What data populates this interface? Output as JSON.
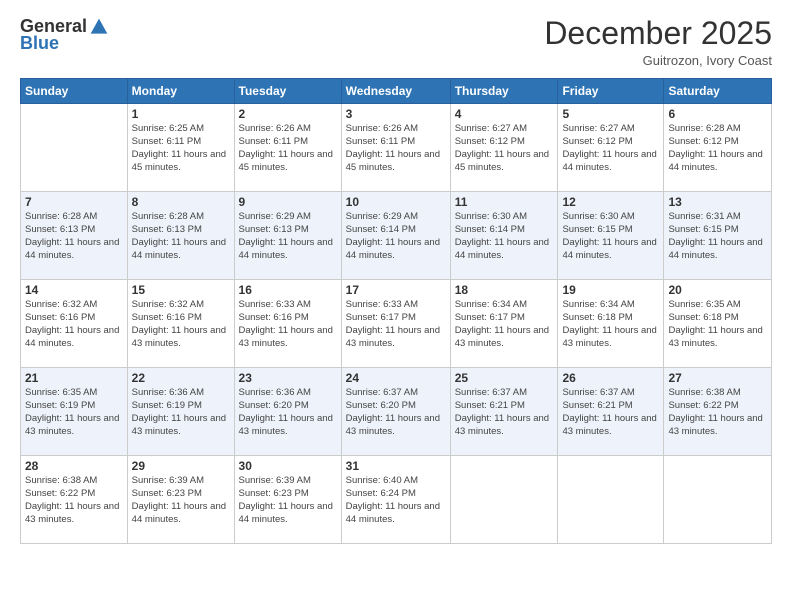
{
  "header": {
    "logo_general": "General",
    "logo_blue": "Blue",
    "month": "December 2025",
    "location": "Guitrozon, Ivory Coast"
  },
  "days_of_week": [
    "Sunday",
    "Monday",
    "Tuesday",
    "Wednesday",
    "Thursday",
    "Friday",
    "Saturday"
  ],
  "weeks": [
    [
      {
        "day": "",
        "sunrise": "",
        "sunset": "",
        "daylight": ""
      },
      {
        "day": "1",
        "sunrise": "Sunrise: 6:25 AM",
        "sunset": "Sunset: 6:11 PM",
        "daylight": "Daylight: 11 hours and 45 minutes."
      },
      {
        "day": "2",
        "sunrise": "Sunrise: 6:26 AM",
        "sunset": "Sunset: 6:11 PM",
        "daylight": "Daylight: 11 hours and 45 minutes."
      },
      {
        "day": "3",
        "sunrise": "Sunrise: 6:26 AM",
        "sunset": "Sunset: 6:11 PM",
        "daylight": "Daylight: 11 hours and 45 minutes."
      },
      {
        "day": "4",
        "sunrise": "Sunrise: 6:27 AM",
        "sunset": "Sunset: 6:12 PM",
        "daylight": "Daylight: 11 hours and 45 minutes."
      },
      {
        "day": "5",
        "sunrise": "Sunrise: 6:27 AM",
        "sunset": "Sunset: 6:12 PM",
        "daylight": "Daylight: 11 hours and 44 minutes."
      },
      {
        "day": "6",
        "sunrise": "Sunrise: 6:28 AM",
        "sunset": "Sunset: 6:12 PM",
        "daylight": "Daylight: 11 hours and 44 minutes."
      }
    ],
    [
      {
        "day": "7",
        "sunrise": "Sunrise: 6:28 AM",
        "sunset": "Sunset: 6:13 PM",
        "daylight": "Daylight: 11 hours and 44 minutes."
      },
      {
        "day": "8",
        "sunrise": "Sunrise: 6:28 AM",
        "sunset": "Sunset: 6:13 PM",
        "daylight": "Daylight: 11 hours and 44 minutes."
      },
      {
        "day": "9",
        "sunrise": "Sunrise: 6:29 AM",
        "sunset": "Sunset: 6:13 PM",
        "daylight": "Daylight: 11 hours and 44 minutes."
      },
      {
        "day": "10",
        "sunrise": "Sunrise: 6:29 AM",
        "sunset": "Sunset: 6:14 PM",
        "daylight": "Daylight: 11 hours and 44 minutes."
      },
      {
        "day": "11",
        "sunrise": "Sunrise: 6:30 AM",
        "sunset": "Sunset: 6:14 PM",
        "daylight": "Daylight: 11 hours and 44 minutes."
      },
      {
        "day": "12",
        "sunrise": "Sunrise: 6:30 AM",
        "sunset": "Sunset: 6:15 PM",
        "daylight": "Daylight: 11 hours and 44 minutes."
      },
      {
        "day": "13",
        "sunrise": "Sunrise: 6:31 AM",
        "sunset": "Sunset: 6:15 PM",
        "daylight": "Daylight: 11 hours and 44 minutes."
      }
    ],
    [
      {
        "day": "14",
        "sunrise": "Sunrise: 6:32 AM",
        "sunset": "Sunset: 6:16 PM",
        "daylight": "Daylight: 11 hours and 44 minutes."
      },
      {
        "day": "15",
        "sunrise": "Sunrise: 6:32 AM",
        "sunset": "Sunset: 6:16 PM",
        "daylight": "Daylight: 11 hours and 43 minutes."
      },
      {
        "day": "16",
        "sunrise": "Sunrise: 6:33 AM",
        "sunset": "Sunset: 6:16 PM",
        "daylight": "Daylight: 11 hours and 43 minutes."
      },
      {
        "day": "17",
        "sunrise": "Sunrise: 6:33 AM",
        "sunset": "Sunset: 6:17 PM",
        "daylight": "Daylight: 11 hours and 43 minutes."
      },
      {
        "day": "18",
        "sunrise": "Sunrise: 6:34 AM",
        "sunset": "Sunset: 6:17 PM",
        "daylight": "Daylight: 11 hours and 43 minutes."
      },
      {
        "day": "19",
        "sunrise": "Sunrise: 6:34 AM",
        "sunset": "Sunset: 6:18 PM",
        "daylight": "Daylight: 11 hours and 43 minutes."
      },
      {
        "day": "20",
        "sunrise": "Sunrise: 6:35 AM",
        "sunset": "Sunset: 6:18 PM",
        "daylight": "Daylight: 11 hours and 43 minutes."
      }
    ],
    [
      {
        "day": "21",
        "sunrise": "Sunrise: 6:35 AM",
        "sunset": "Sunset: 6:19 PM",
        "daylight": "Daylight: 11 hours and 43 minutes."
      },
      {
        "day": "22",
        "sunrise": "Sunrise: 6:36 AM",
        "sunset": "Sunset: 6:19 PM",
        "daylight": "Daylight: 11 hours and 43 minutes."
      },
      {
        "day": "23",
        "sunrise": "Sunrise: 6:36 AM",
        "sunset": "Sunset: 6:20 PM",
        "daylight": "Daylight: 11 hours and 43 minutes."
      },
      {
        "day": "24",
        "sunrise": "Sunrise: 6:37 AM",
        "sunset": "Sunset: 6:20 PM",
        "daylight": "Daylight: 11 hours and 43 minutes."
      },
      {
        "day": "25",
        "sunrise": "Sunrise: 6:37 AM",
        "sunset": "Sunset: 6:21 PM",
        "daylight": "Daylight: 11 hours and 43 minutes."
      },
      {
        "day": "26",
        "sunrise": "Sunrise: 6:37 AM",
        "sunset": "Sunset: 6:21 PM",
        "daylight": "Daylight: 11 hours and 43 minutes."
      },
      {
        "day": "27",
        "sunrise": "Sunrise: 6:38 AM",
        "sunset": "Sunset: 6:22 PM",
        "daylight": "Daylight: 11 hours and 43 minutes."
      }
    ],
    [
      {
        "day": "28",
        "sunrise": "Sunrise: 6:38 AM",
        "sunset": "Sunset: 6:22 PM",
        "daylight": "Daylight: 11 hours and 43 minutes."
      },
      {
        "day": "29",
        "sunrise": "Sunrise: 6:39 AM",
        "sunset": "Sunset: 6:23 PM",
        "daylight": "Daylight: 11 hours and 44 minutes."
      },
      {
        "day": "30",
        "sunrise": "Sunrise: 6:39 AM",
        "sunset": "Sunset: 6:23 PM",
        "daylight": "Daylight: 11 hours and 44 minutes."
      },
      {
        "day": "31",
        "sunrise": "Sunrise: 6:40 AM",
        "sunset": "Sunset: 6:24 PM",
        "daylight": "Daylight: 11 hours and 44 minutes."
      },
      {
        "day": "",
        "sunrise": "",
        "sunset": "",
        "daylight": ""
      },
      {
        "day": "",
        "sunrise": "",
        "sunset": "",
        "daylight": ""
      },
      {
        "day": "",
        "sunrise": "",
        "sunset": "",
        "daylight": ""
      }
    ]
  ]
}
